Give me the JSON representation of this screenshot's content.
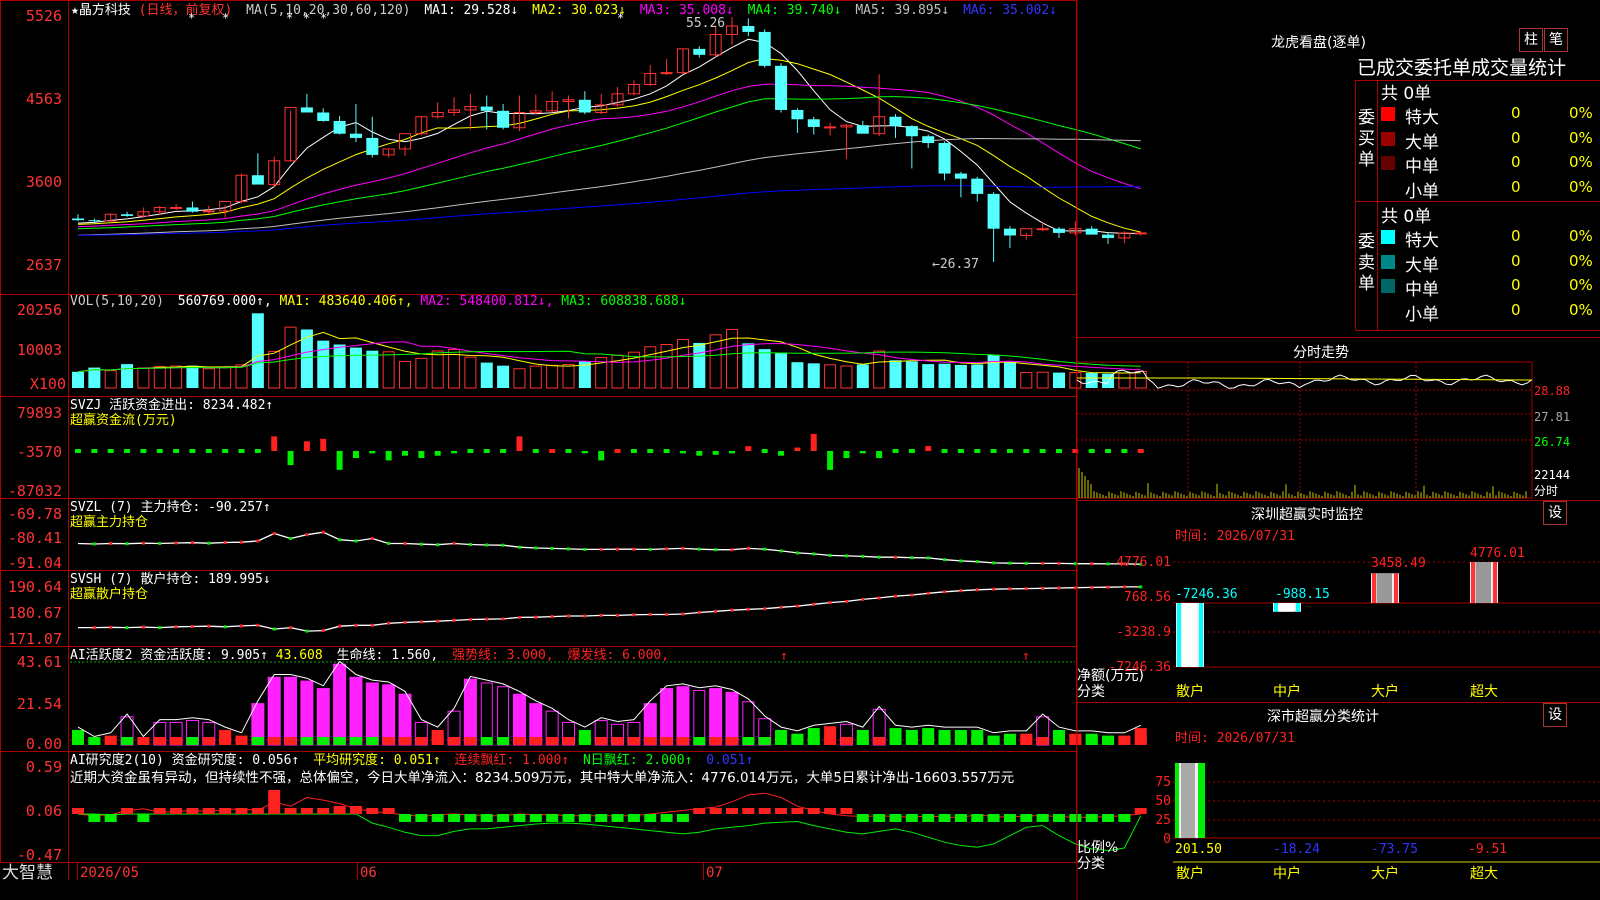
{
  "app": {
    "logo": "大智慧"
  },
  "main_chart": {
    "stock_name": "★晶方科技",
    "period_label": "(日线，前复权)",
    "ma_title": "MA(5,10,20,30,60,120)",
    "ma_values": [
      {
        "label": "MA1: 29.528↓",
        "color": "#ffffff"
      },
      {
        "label": "MA2: 30.023↓",
        "color": "#ffff00"
      },
      {
        "label": "MA3: 35.008↓",
        "color": "#ff00ff"
      },
      {
        "label": "MA4: 39.740↓",
        "color": "#00ff00"
      },
      {
        "label": "MA5: 39.895↓",
        "color": "#c0c0c0"
      },
      {
        "label": "MA6: 35.002↓",
        "color": "#0000ff"
      }
    ],
    "y_labels": [
      "5526",
      "4563",
      "3600",
      "2637"
    ],
    "max_label": "55.26",
    "min_label": "←26.37"
  },
  "volume": {
    "title": "VOL(5,10,20)",
    "value": "560769.000↑,",
    "ma1": "MA1: 483640.406↑,",
    "ma2": "MA2: 548400.812↓,",
    "ma3": "MA3: 608838.688↓",
    "y_labels": [
      "20256",
      "10003",
      "X100"
    ]
  },
  "svzj": {
    "title": "SVZJ  活跃资金进出: 8234.482↑",
    "subtitle": "超赢资金流(万元)",
    "y_labels": [
      "79893",
      "-3570",
      "-87032"
    ]
  },
  "svzl": {
    "title": "SVZL (7) 主力持仓: -90.257↑",
    "subtitle": "超赢主力持仓",
    "y_labels": [
      "-69.78",
      "-80.41",
      "-91.04"
    ]
  },
  "svsh": {
    "title": "SVSH (7) 散户持仓: 189.995↓",
    "subtitle": "超赢散户持仓",
    "y_labels": [
      "190.64",
      "180.67",
      "171.07"
    ]
  },
  "ai_active": {
    "title": "AI活跃度2 资金活跃度: 9.905↑",
    "val2": "43.608",
    "life": "生命线: 1.560,",
    "strong": "强势线: 3.000,",
    "burst": "爆发线: 6.000,",
    "y_labels": [
      "43.61",
      "21.54",
      "0.00"
    ]
  },
  "ai_research": {
    "title": "AI研究度2(10) 资金研究度: 0.056↑",
    "avg": "平均研究度: 0.051↑",
    "cont": "连续飘红: 1.000↑",
    "nday": "N日飘红: 2.000↑",
    "last": "0.051↑",
    "comment": "近期大资金虽有异动，但持续性不强，总体偏空，今日大单净流入：8234.509万元，其中特大单净流入：4776.014万元，大单5日累计净出-16603.557万元",
    "y_labels": [
      "0.59",
      "0.06",
      "-0.47"
    ]
  },
  "x_axis": {
    "labels": [
      "2026/05",
      "06",
      "07"
    ]
  },
  "right_panel": {
    "dragon_title": "龙虎看盘(逐单)",
    "btn_bar": "柱",
    "btn_pen": "笔",
    "order_title": "已成交委托单成交量统计",
    "buy_label": "委买单",
    "sell_label": "委卖单",
    "buy_total": "共 0单",
    "sell_total": "共 0单",
    "buy_rows": [
      {
        "name": "特大",
        "count": "0",
        "pct": "0%",
        "color": "#ff0000"
      },
      {
        "name": "大单",
        "count": "0",
        "pct": "0%",
        "color": "#990000"
      },
      {
        "name": "中单",
        "count": "0",
        "pct": "0%",
        "color": "#660000"
      },
      {
        "name": "小单",
        "count": "0",
        "pct": "0%",
        "color": "#000000"
      }
    ],
    "sell_rows": [
      {
        "name": "特大",
        "count": "0",
        "pct": "0%",
        "color": "#00ffff"
      },
      {
        "name": "大单",
        "count": "0",
        "pct": "0%",
        "color": "#008888"
      },
      {
        "name": "中单",
        "count": "0",
        "pct": "0%",
        "color": "#006666"
      },
      {
        "name": "小单",
        "count": "0",
        "pct": "0%",
        "color": "#000000"
      }
    ],
    "intraday_title": "分时走势",
    "intraday_labels": [
      "28.88",
      "27.81",
      "26.74",
      "22144",
      "分时"
    ],
    "monitor_title": "深圳超赢实时监控",
    "settings_btn": "设",
    "monitor_time": "时间: 2026/07/31",
    "monitor_y": [
      "4776.01",
      "768.56",
      "-3238.9",
      "-7246.36"
    ],
    "monitor_axis_label": "净额(万元)",
    "monitor_axis_label2": "分类",
    "monitor_bar_labels": [
      "-7246.36",
      "-988.15",
      "3458.49",
      "4776.01"
    ],
    "categories": [
      "散户",
      "中户",
      "大户",
      "超大"
    ],
    "class_title": "深市超赢分类统计",
    "class_time": "时间: 2026/07/31",
    "class_y": [
      "75",
      "50",
      "25",
      "0"
    ],
    "class_axis_label": "比例%",
    "class_axis_label2": "分类",
    "class_values": [
      "201.50",
      "-18.24",
      "-73.75",
      "-9.51"
    ]
  },
  "chart_data": [
    {
      "type": "candlestick",
      "title": "晶方科技 (日线，前复权)",
      "ylim": [
        26.37,
        55.26
      ],
      "x": [
        "2026/05",
        "06",
        "07"
      ],
      "series": [
        {
          "name": "O",
          "values": [
            31.5,
            31.3,
            31.2,
            32.0,
            31.8,
            32.3,
            32.8,
            32.8,
            32.3,
            32.4,
            33.5,
            36.6,
            35.5,
            38.3,
            44.6,
            44.0,
            43.0,
            41.5,
            41.0,
            39.0,
            39.7,
            41.5,
            43.5,
            44.0,
            44.3,
            44.7,
            44.2,
            42.2,
            44.0,
            44.2,
            45.3,
            45.5,
            44.0,
            44.9,
            46.2,
            47.3,
            48.6,
            48.7,
            51.5,
            50.8,
            53.2,
            54.2,
            53.5,
            49.5,
            44.3,
            43.2,
            42.3,
            42.3,
            42.5,
            41.5,
            43.5,
            42.4,
            41.2,
            40.4,
            36.8,
            36.2,
            34.4,
            30.3,
            29.5,
            30.3,
            30.3,
            29.8,
            30.3,
            29.6,
            29.2,
            29.8
          ]
        },
        {
          "name": "H",
          "values": [
            32.0,
            31.5,
            32.1,
            32.3,
            32.8,
            33.0,
            33.2,
            33.5,
            33.0,
            33.1,
            36.8,
            39.2,
            38.8,
            44.2,
            46.2,
            44.5,
            43.6,
            45.0,
            43.5,
            39.6,
            40.0,
            43.5,
            45.2,
            45.8,
            46.2,
            46.0,
            45.0,
            46.0,
            46.1,
            46.5,
            46.0,
            46.5,
            46.2,
            47.0,
            47.8,
            49.6,
            50.3,
            51.5,
            51.8,
            54.1,
            55.26,
            55.1,
            53.8,
            49.8,
            44.5,
            43.5,
            42.8,
            42.6,
            43.0,
            48.5,
            43.8,
            42.5,
            41.4,
            40.6,
            37.0,
            36.4,
            34.6,
            30.6,
            29.8,
            31.0,
            30.5,
            31.2,
            30.6,
            29.8,
            30.0,
            30.0
          ]
        },
        {
          "name": "L",
          "values": [
            31.2,
            30.9,
            31.1,
            31.7,
            31.6,
            31.9,
            32.5,
            32.2,
            32.0,
            31.6,
            33.3,
            36.3,
            35.2,
            38.2,
            44.0,
            42.9,
            41.4,
            40.5,
            38.7,
            38.7,
            38.9,
            41.3,
            43.3,
            43.6,
            42.0,
            42.0,
            42.0,
            41.8,
            43.8,
            44.0,
            43.3,
            43.8,
            43.8,
            44.7,
            46.0,
            47.1,
            48.4,
            48.5,
            50.5,
            50.5,
            52.0,
            53.0,
            49.3,
            44.0,
            41.6,
            41.4,
            41.3,
            38.5,
            41.8,
            41.2,
            41.0,
            37.4,
            39.8,
            36.0,
            34.0,
            33.5,
            26.37,
            28.0,
            29.0,
            30.0,
            29.2,
            29.5,
            29.7,
            28.5,
            28.6,
            29.5
          ]
        },
        {
          "name": "C",
          "values": [
            31.3,
            31.2,
            32.0,
            31.8,
            32.3,
            32.8,
            32.8,
            32.3,
            32.4,
            33.5,
            36.6,
            35.5,
            38.3,
            44.6,
            44.0,
            43.0,
            41.5,
            41.0,
            39.0,
            39.7,
            41.5,
            43.5,
            44.0,
            44.3,
            44.7,
            44.2,
            42.2,
            44.0,
            44.2,
            45.3,
            45.5,
            44.0,
            44.9,
            46.2,
            47.3,
            48.6,
            48.7,
            51.5,
            50.8,
            53.2,
            54.2,
            53.5,
            49.5,
            44.3,
            43.2,
            42.3,
            42.3,
            42.5,
            41.5,
            43.5,
            42.4,
            41.2,
            40.4,
            36.8,
            36.2,
            34.4,
            30.3,
            29.5,
            30.3,
            30.3,
            29.8,
            30.3,
            29.6,
            29.2,
            29.8,
            29.8
          ]
        }
      ]
    },
    {
      "type": "bar",
      "title": "VOL(5,10,20)",
      "series": [
        {
          "name": "VOL",
          "values": [
            4200,
            5300,
            4500,
            6200,
            5200,
            5600,
            5700,
            5800,
            5000,
            5300,
            6000,
            19400,
            9500,
            15800,
            15200,
            12300,
            11300,
            10500,
            9700,
            9400,
            6900,
            7700,
            9600,
            10000,
            8000,
            6600,
            5800,
            5000,
            5700,
            5900,
            6100,
            7000,
            7900,
            8500,
            9300,
            10700,
            11300,
            12600,
            11700,
            13800,
            15200,
            11600,
            10100,
            9200,
            6700,
            6400,
            6000,
            5700,
            6100,
            9600,
            7200,
            6900,
            6200,
            6300,
            6000,
            6100,
            8600,
            6700,
            4000,
            4100,
            4000,
            4000,
            3900,
            3700,
            3900,
            4300
          ]
        }
      ]
    },
    {
      "type": "bar",
      "title": "SVZJ 活跃资金进出",
      "series": [
        {
          "name": "SVZJ",
          "values": [
            -2000,
            -1200,
            -1500,
            -1800,
            -1000,
            -1300,
            -1400,
            -1600,
            -1200,
            -1900,
            -2200,
            -1500,
            30000,
            -30000,
            20000,
            25000,
            -40000,
            -15000,
            -5000,
            -20000,
            -10000,
            -15000,
            -10000,
            -5000,
            -1500,
            -1800,
            -1000,
            30000,
            -2000,
            1500,
            -3000,
            -5000,
            -20000,
            1000,
            -1500,
            -1200,
            -3000,
            -5000,
            -10000,
            -8000,
            -5000,
            10000,
            -2000,
            -10000,
            7000,
            35000,
            -40000,
            -15000,
            -5000,
            -15000,
            -2000,
            -1200,
            10000,
            -2000,
            -1500,
            -1800,
            -1000,
            -1300,
            -1400,
            -1600,
            -1200,
            1500,
            -1000,
            -1500,
            -1200,
            3000
          ]
        }
      ]
    },
    {
      "type": "line",
      "title": "SVZL 主力持仓",
      "series": [
        {
          "name": "SVZL",
          "values": [
            -82.0,
            -82.2,
            -82.0,
            -82.1,
            -81.9,
            -82.0,
            -81.8,
            -81.7,
            -81.9,
            -81.6,
            -81.5,
            -81.0,
            -78.0,
            -80.0,
            -78.5,
            -77.5,
            -80.5,
            -81.0,
            -80.0,
            -82.0,
            -82.0,
            -82.3,
            -82.5,
            -82.0,
            -82.4,
            -82.6,
            -82.7,
            -83.5,
            -83.8,
            -84.0,
            -84.2,
            -84.4,
            -84.4,
            -84.3,
            -84.3,
            -84.4,
            -84.2,
            -84.0,
            -84.3,
            -84.5,
            -84.5,
            -84.0,
            -84.3,
            -85.0,
            -85.8,
            -86.2,
            -86.8,
            -87.0,
            -87.2,
            -87.5,
            -87.5,
            -87.7,
            -87.8,
            -88.5,
            -89.0,
            -89.3,
            -89.8,
            -89.9,
            -90.0,
            -90.0,
            -90.0,
            -90.1,
            -90.1,
            -90.2,
            -90.2,
            -90.3
          ]
        }
      ]
    },
    {
      "type": "line",
      "title": "SVSH 散户持仓",
      "series": [
        {
          "name": "SVSH",
          "values": [
            176.0,
            176.0,
            176.1,
            176.0,
            176.2,
            176.0,
            176.3,
            176.4,
            176.5,
            176.3,
            176.6,
            176.8,
            175.5,
            176.0,
            174.8,
            175.0,
            176.5,
            176.8,
            176.8,
            177.5,
            177.8,
            178.0,
            178.2,
            178.5,
            178.8,
            178.9,
            179.0,
            179.5,
            179.6,
            179.8,
            180.0,
            180.0,
            180.2,
            180.2,
            180.4,
            180.5,
            180.5,
            180.7,
            181.2,
            181.6,
            182.0,
            182.3,
            182.5,
            183.0,
            183.4,
            184.0,
            184.6,
            185.0,
            185.7,
            186.2,
            186.8,
            187.2,
            187.8,
            188.3,
            188.7,
            189.0,
            189.2,
            189.3,
            189.4,
            189.5,
            189.6,
            189.7,
            189.8,
            189.9,
            190.0,
            189.995
          ]
        }
      ]
    },
    {
      "type": "bar",
      "title": "AI活跃度2 资金活跃度",
      "series": [
        {
          "name": "活跃度",
          "values": [
            8,
            3,
            5,
            15,
            3,
            12,
            12,
            13,
            12,
            8,
            5,
            22,
            36,
            36,
            34,
            30,
            43,
            36,
            33,
            32,
            27,
            12,
            8,
            18,
            35,
            33,
            31,
            27,
            22,
            18,
            12,
            8,
            13,
            11,
            12,
            22,
            30,
            31,
            29,
            30,
            28,
            23,
            14,
            8,
            6,
            9,
            10,
            11,
            8,
            19,
            9,
            8,
            9,
            8,
            8,
            8,
            5,
            6,
            6,
            15,
            8,
            6,
            6,
            5,
            5,
            9
          ]
        }
      ]
    },
    {
      "type": "bar",
      "title": "AI研究度2(10) 资金研究度",
      "series": [
        {
          "name": "研究度",
          "values": [
            0.02,
            -0.04,
            -0.01,
            0.03,
            -0.02,
            0.01,
            0.01,
            0.01,
            0.01,
            0.01,
            0.01,
            0.01,
            0.01,
            0.01,
            0.01,
            0.01,
            0.01,
            0.01,
            0.01,
            0.01,
            -0.06,
            -0.06,
            -0.06,
            -0.06,
            -0.06,
            -0.06,
            -0.06,
            -0.06,
            -0.06,
            -0.06,
            -0.06,
            -0.06,
            -0.06,
            -0.06,
            -0.06,
            -0.06,
            -0.06,
            -0.06,
            0.01,
            0.01,
            0.01,
            0.01,
            0.01,
            0.01,
            0.01,
            0.01,
            0.01,
            0.01,
            -0.06,
            -0.06,
            -0.06,
            -0.06,
            -0.06,
            -0.06,
            -0.06,
            -0.06,
            -0.06,
            -0.06,
            -0.06,
            -0.06,
            -0.06,
            -0.06,
            -0.06,
            -0.06,
            -0.06,
            0.01
          ]
        }
      ]
    },
    {
      "type": "bar",
      "title": "深圳超赢实时监控",
      "categories": [
        "散户",
        "中户",
        "大户",
        "超大"
      ],
      "values": [
        -7246.36,
        -988.15,
        3458.49,
        4776.01
      ],
      "ylim": [
        -7246.36,
        4776.01
      ]
    },
    {
      "type": "bar",
      "title": "深市超赢分类统计",
      "categories": [
        "散户",
        "中户",
        "大户",
        "超大"
      ],
      "values": [
        201.5,
        -18.24,
        -73.75,
        -9.51
      ],
      "ylim": [
        0,
        75
      ]
    }
  ]
}
